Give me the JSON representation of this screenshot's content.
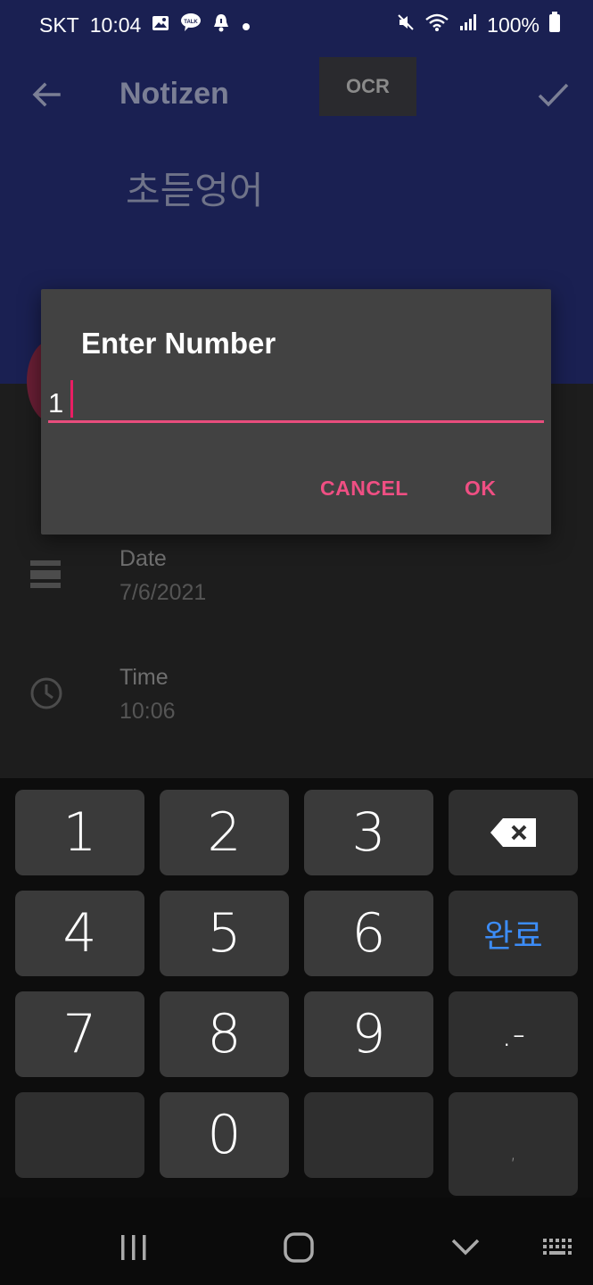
{
  "status_bar": {
    "carrier": "SKT",
    "time": "10:04",
    "battery": "100%",
    "left_icons": [
      "image-icon",
      "talk-icon",
      "alarm-icon",
      "dot-icon"
    ],
    "right_icons": [
      "mute-icon",
      "wifi-icon",
      "signal-icon",
      "battery-icon"
    ]
  },
  "toolbar": {
    "title": "Notizen",
    "ocr_label": "OCR"
  },
  "note": {
    "title": "초듣엉어"
  },
  "details": {
    "date_label": "Date",
    "date_value": "7/6/2021",
    "time_label": "Time",
    "time_value": "10:06"
  },
  "dialog": {
    "title": "Enter Number",
    "input_value": "1",
    "cancel_label": "CANCEL",
    "ok_label": "OK"
  },
  "keyboard": {
    "keys": [
      "1",
      "2",
      "3",
      "4",
      "5",
      "6",
      "7",
      "8",
      "9",
      "0"
    ],
    "done_label": "완료",
    "punct_label": ".-",
    "comma_label": ","
  },
  "colors": {
    "header_bg": "#1a2052",
    "dialog_bg": "#424242",
    "accent": "#ef4f83",
    "done_key": "#3c8cf7"
  }
}
